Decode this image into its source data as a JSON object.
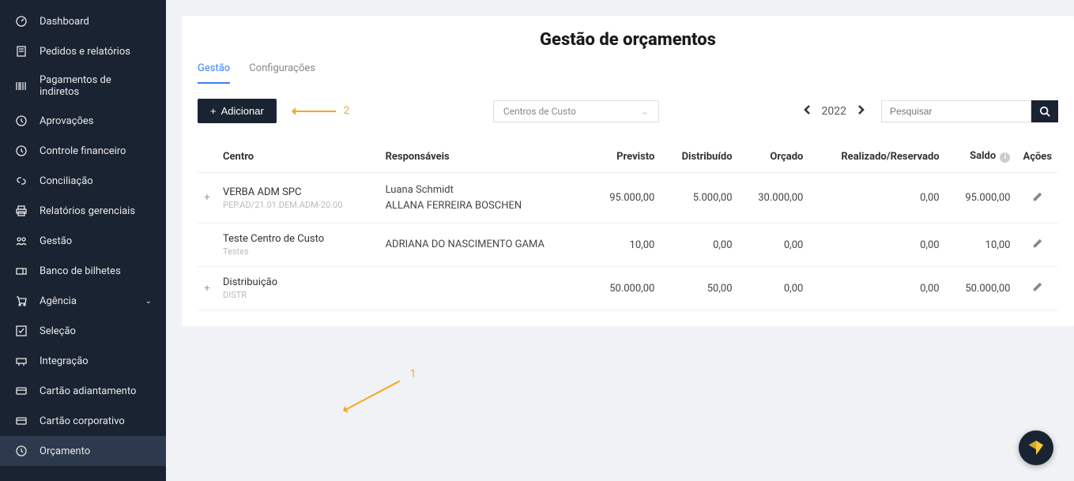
{
  "sidebar": {
    "items": [
      {
        "label": "Dashboard",
        "icon": "gauge"
      },
      {
        "label": "Pedidos e relatórios",
        "icon": "document"
      },
      {
        "label": "Pagamentos de indiretos",
        "icon": "barcode"
      },
      {
        "label": "Aprovações",
        "icon": "clock"
      },
      {
        "label": "Controle financeiro",
        "icon": "clock"
      },
      {
        "label": "Conciliação",
        "icon": "link"
      },
      {
        "label": "Relatórios gerenciais",
        "icon": "printer"
      },
      {
        "label": "Gestão",
        "icon": "users"
      },
      {
        "label": "Banco de bilhetes",
        "icon": "ticket"
      },
      {
        "label": "Agência",
        "icon": "cart",
        "chevron": true
      },
      {
        "label": "Seleção",
        "icon": "check-square"
      },
      {
        "label": "Integração",
        "icon": "plug"
      },
      {
        "label": "Cartão adiantamento",
        "icon": "card"
      },
      {
        "label": "Cartão corporativo",
        "icon": "card"
      },
      {
        "label": "Orçamento",
        "icon": "clock",
        "active": true
      }
    ]
  },
  "page": {
    "title": "Gestão de orçamentos"
  },
  "tabs": [
    {
      "label": "Gestão",
      "active": true
    },
    {
      "label": "Configurações"
    }
  ],
  "toolbar": {
    "add_label": "Adicionar",
    "filter_label": "Centros de Custo",
    "year": "2022",
    "search_placeholder": "Pesquisar"
  },
  "annotations": {
    "one": "1",
    "two": "2"
  },
  "table": {
    "headers": {
      "centro": "Centro",
      "responsaveis": "Responsáveis",
      "previsto": "Previsto",
      "distribuido": "Distribuído",
      "orcado": "Orçado",
      "realizado": "Realizado/Reservado",
      "saldo": "Saldo",
      "acoes": "Ações"
    },
    "rows": [
      {
        "expandable": true,
        "centro": "VERBA ADM SPC",
        "centro_sub": "PEP.AD/21.01.DEM.ADM-20.00",
        "responsaveis": [
          "Luana Schmidt",
          "ALLANA FERREIRA BOSCHEN"
        ],
        "previsto": "95.000,00",
        "distribuido": "5.000,00",
        "orcado": "30.000,00",
        "realizado": "0,00",
        "saldo": "95.000,00"
      },
      {
        "expandable": false,
        "centro": "Teste Centro de Custo",
        "centro_sub": "Testes",
        "responsaveis": [
          "ADRIANA DO NASCIMENTO GAMA"
        ],
        "previsto": "10,00",
        "distribuido": "0,00",
        "orcado": "0,00",
        "realizado": "0,00",
        "saldo": "10,00"
      },
      {
        "expandable": true,
        "centro": "Distribuição",
        "centro_sub": "DISTR",
        "responsaveis": [],
        "previsto": "50.000,00",
        "distribuido": "50,00",
        "orcado": "0,00",
        "realizado": "0,00",
        "saldo": "50.000,00"
      }
    ]
  }
}
